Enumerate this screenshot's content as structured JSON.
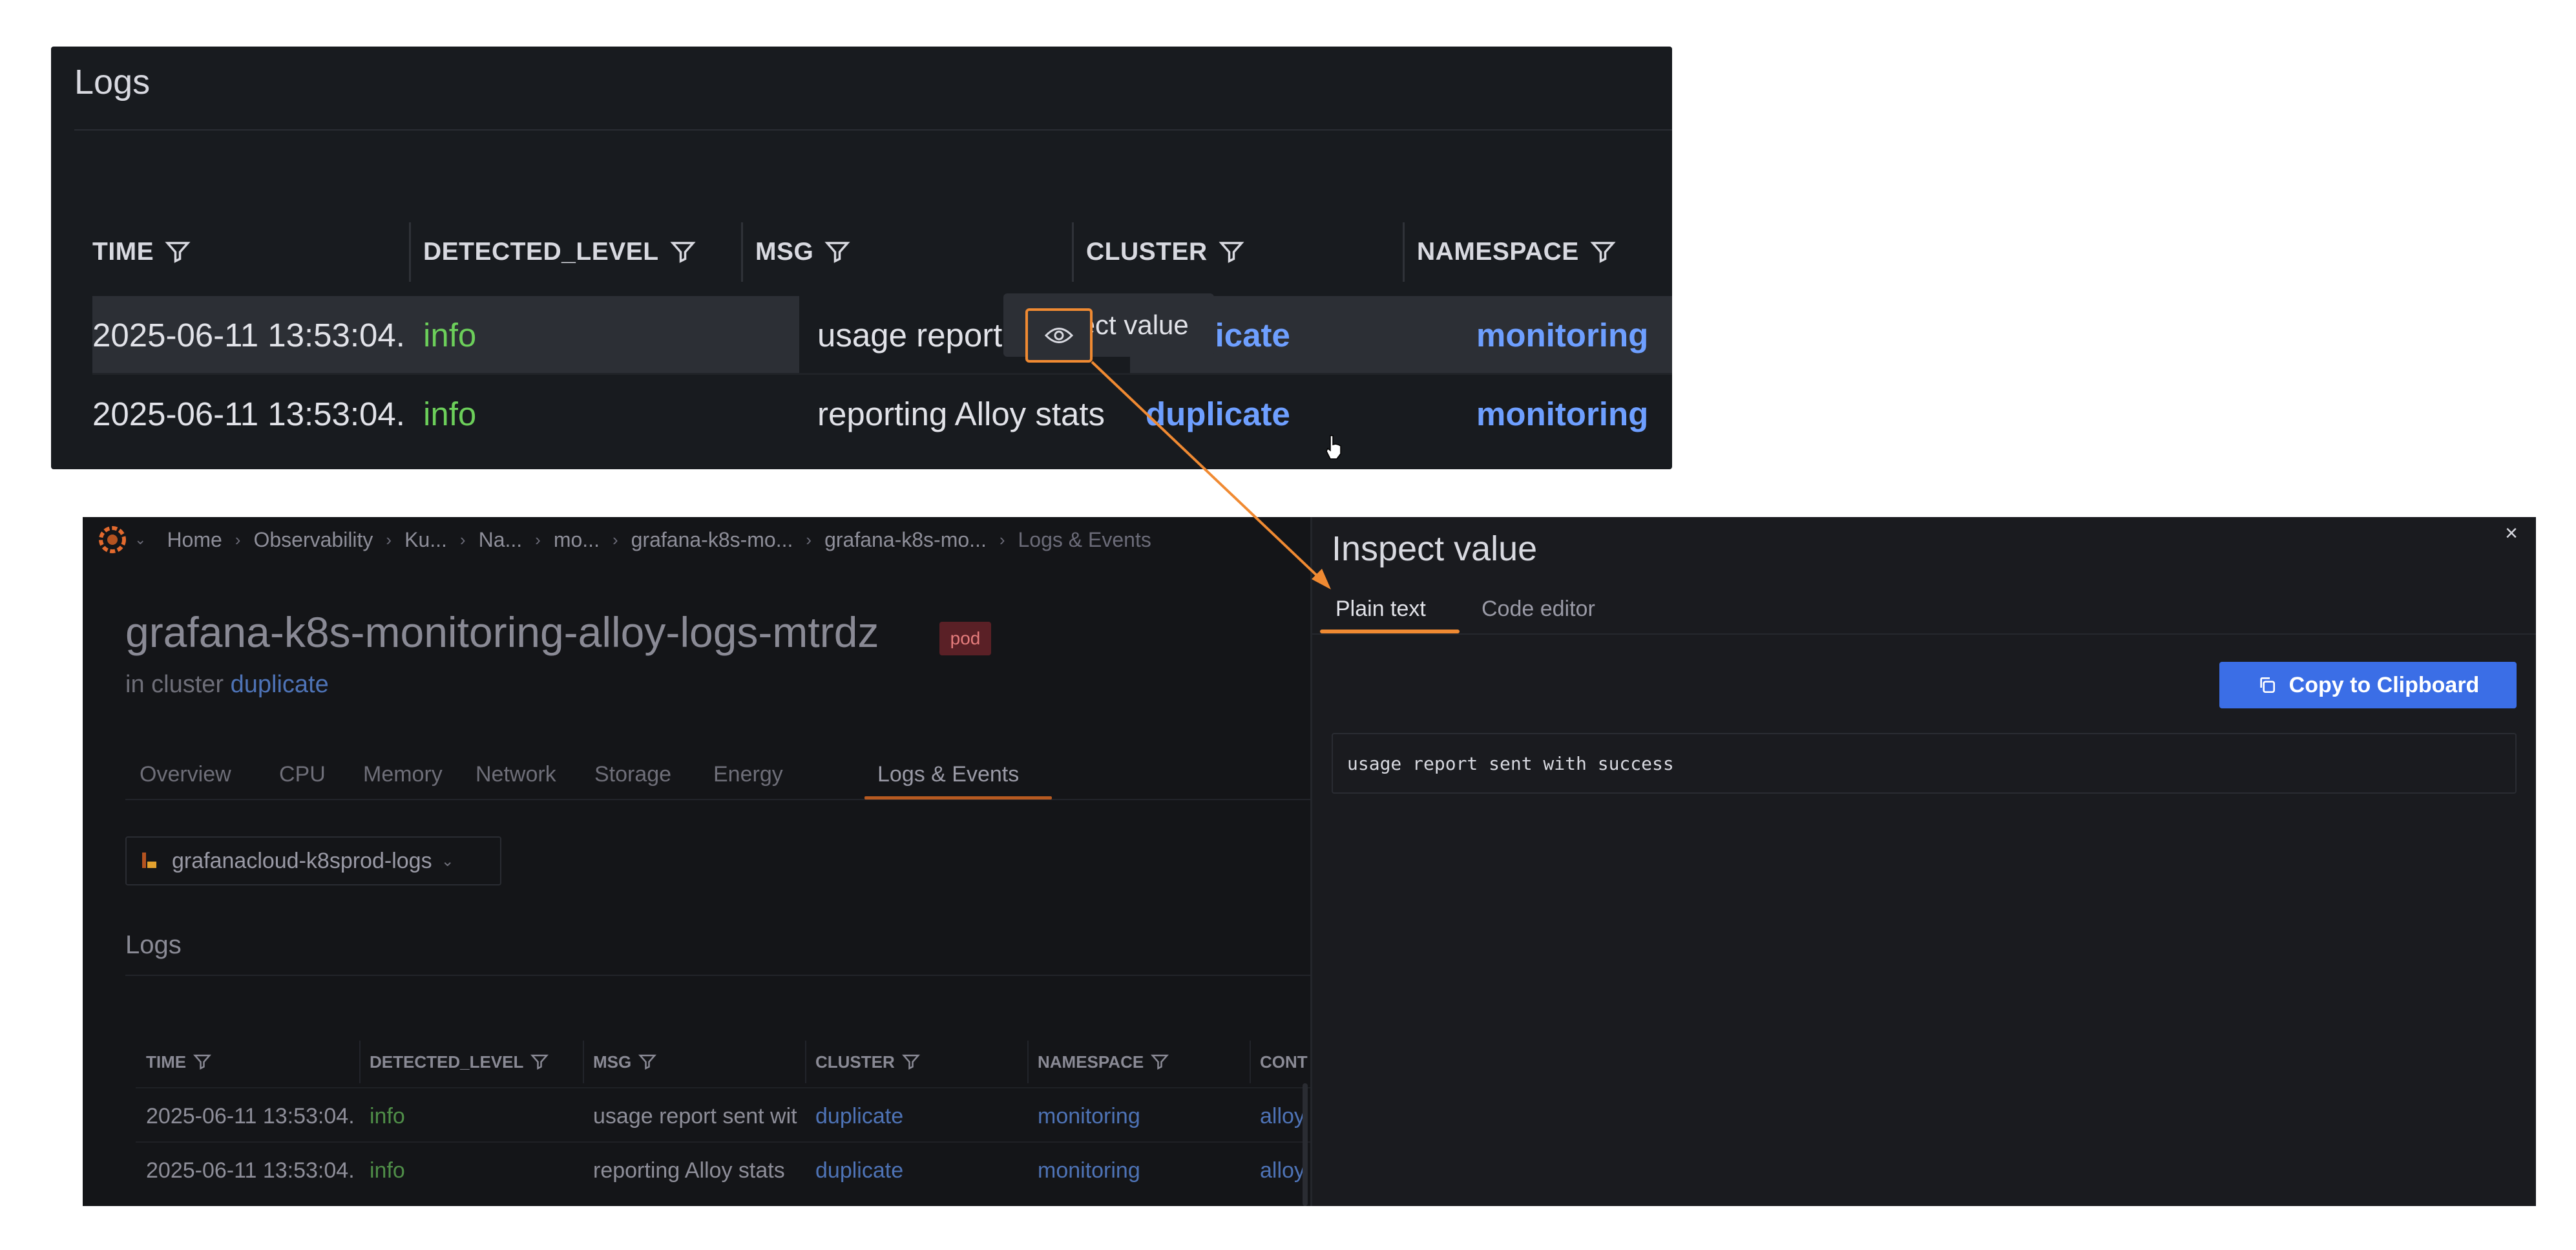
{
  "zoom": {
    "title": "Logs",
    "columns": [
      "TIME",
      "DETECTED_LEVEL",
      "MSG",
      "CLUSTER",
      "NAMESPACE"
    ],
    "rows": [
      {
        "time": "2025-06-11 13:53:04.",
        "level": "info",
        "msg": "usage report sent",
        "cluster": "duplicate",
        "namespace": "monitoring"
      },
      {
        "time": "2025-06-11 13:53:04.",
        "level": "info",
        "msg": "reporting Alloy stats",
        "cluster": "duplicate",
        "namespace": "monitoring"
      }
    ],
    "tooltip": "Inspect value",
    "eye_icon": "eye-icon"
  },
  "breadcrumb": [
    "Home",
    "Observability",
    "Ku...",
    "Na...",
    "mo...",
    "grafana-k8s-mo...",
    "grafana-k8s-mo...",
    "Logs & Events"
  ],
  "page": {
    "title": "grafana-k8s-monitoring-alloy-logs-mtrdz",
    "badge": "pod",
    "subtitle_prefix": "in cluster",
    "subtitle_link": "duplicate"
  },
  "tabs": [
    "Overview",
    "CPU",
    "Memory",
    "Network",
    "Storage",
    "Energy",
    "Logs & Events"
  ],
  "active_tab": "Logs & Events",
  "datasource": "grafanacloud-k8sprod-logs",
  "logs": {
    "title": "Logs",
    "columns": [
      "TIME",
      "DETECTED_LEVEL",
      "MSG",
      "CLUSTER",
      "NAMESPACE",
      "CONT"
    ],
    "rows": [
      {
        "time": "2025-06-11 13:53:04.",
        "level": "info",
        "msg": "usage report sent wit",
        "cluster": "duplicate",
        "namespace": "monitoring",
        "container": "alloy"
      },
      {
        "time": "2025-06-11 13:53:04.",
        "level": "info",
        "msg": "reporting Alloy stats",
        "cluster": "duplicate",
        "namespace": "monitoring",
        "container": "alloy"
      }
    ]
  },
  "drawer": {
    "title": "Inspect value",
    "close": "×",
    "tabs": [
      "Plain text",
      "Code editor"
    ],
    "copy_label": "Copy to Clipboard",
    "value": "usage report sent with success"
  },
  "colors": {
    "accent_orange": "#f08a32",
    "link_blue": "#6e9fff",
    "info_green": "#6ccf5a",
    "primary_button": "#3b6ee6"
  }
}
